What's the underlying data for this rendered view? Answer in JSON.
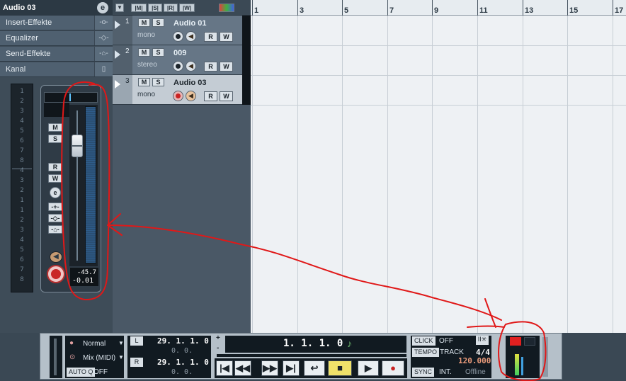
{
  "inspector": {
    "title": "Audio 03",
    "e_button": "e",
    "sections": [
      {
        "label": "Insert-Effekte",
        "icon": "-o-"
      },
      {
        "label": "Equalizer",
        "icon": "-◇-"
      },
      {
        "label": "Send-Effekte",
        "icon": "-⌂-"
      },
      {
        "label": "Kanal",
        "icon": "▯"
      }
    ],
    "channel_numbers": [
      "1",
      "2",
      "3",
      "4",
      "5",
      "6",
      "7",
      "8",
      "4",
      "3",
      "2",
      "1",
      "1",
      "2",
      "3",
      "4",
      "5",
      "6",
      "7",
      "8"
    ],
    "fader": {
      "buttons": [
        "M",
        "S",
        "R",
        "W",
        "e"
      ],
      "peak": "-45.7",
      "value": "-0.01"
    }
  },
  "tracklist_header": {
    "buttons": [
      "|M|",
      "|S|",
      "|R|",
      "|W|"
    ]
  },
  "tracks": [
    {
      "num": "1",
      "name": "Audio 01",
      "mode": "mono",
      "selected": false,
      "rec": false,
      "monitor": false
    },
    {
      "num": "2",
      "name": "009",
      "mode": "stereo",
      "selected": false,
      "rec": false,
      "monitor": false
    },
    {
      "num": "3",
      "name": "Audio 03",
      "mode": "mono",
      "selected": true,
      "rec": true,
      "monitor": true
    }
  ],
  "track_buttons": {
    "mute": "M",
    "solo": "S",
    "read": "R",
    "write": "W"
  },
  "ruler": {
    "labels": [
      "1",
      "3",
      "5",
      "7",
      "9",
      "11",
      "13",
      "15",
      "17"
    ]
  },
  "transport": {
    "mode1": "Normal",
    "mode2": "Mix (MIDI)",
    "autoq_label": "AUTO Q",
    "autoq_value": "OFF",
    "left_locator": "29. 1. 1.    0",
    "left_sub": "0.  0.",
    "right_locator": "29. 1. 1.    0",
    "right_sub": "0.  0.",
    "position": "1. 1. 1.    0",
    "click_label": "CLICK",
    "click_value": "OFF",
    "tempo_label": "TEMPO",
    "tempo_mode": "TRACK",
    "signature": "4/4",
    "tempo": "120.000",
    "sync_label": "SYNC",
    "sync_mode": "INT.",
    "sync_state": "Offline",
    "l_label": "L",
    "r_label": "R",
    "plus": "+",
    "minus": "-",
    "buttons": [
      "|◀",
      "◀◀",
      "▶▶",
      "▶|",
      "↩",
      "■",
      "▶",
      "●"
    ]
  },
  "colors": {
    "annotation": "#e01818",
    "grid_bg": "#eef1f4",
    "cycle_yellow": "#f0e26a"
  }
}
